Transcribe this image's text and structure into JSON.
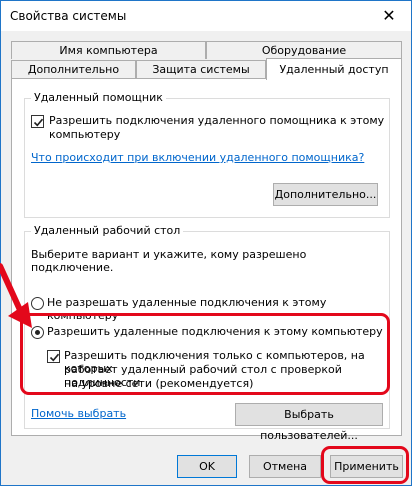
{
  "window": {
    "title": "Свойства системы",
    "close_glyph": "✕"
  },
  "tabs": {
    "row_back": [
      {
        "label": "Имя компьютера"
      },
      {
        "label": "Оборудование"
      }
    ],
    "row_front": [
      {
        "label": "Дополнительно"
      },
      {
        "label": "Защита системы"
      },
      {
        "label": "Удаленный доступ",
        "active": true
      }
    ]
  },
  "remote_assistance": {
    "group_label": "Удаленный помощник",
    "allow_checkbox": {
      "checked": true,
      "label_line1": "Разрешить подключения удаленного помощника к этому",
      "label_line2": "компьютеру"
    },
    "info_link": "Что происходит при включении удаленного помощника?",
    "advanced_button": "Дополнительно..."
  },
  "remote_desktop": {
    "group_label": "Удаленный рабочий стол",
    "instruction": "Выберите вариант и укажите, кому разрешено подключение.",
    "radio_deny": {
      "selected": false,
      "label": "Не разрешать удаленные подключения к этому компьютеру"
    },
    "radio_allow": {
      "selected": true,
      "label": "Разрешить удаленные подключения к этому компьютеру"
    },
    "nla_checkbox": {
      "checked": true,
      "label_line1": "Разрешить подключения только с компьютеров, на которых",
      "label_line2": "работает удаленный рабочий стол с проверкой подлинности",
      "label_line3": "на уровне сети (рекомендуется)"
    },
    "help_link": "Помочь выбрать",
    "select_users_button": "Выбрать пользователей..."
  },
  "footer": {
    "ok": "OK",
    "cancel": "Отмена",
    "apply": "Применить"
  },
  "colors": {
    "annotation_red": "#e3081b",
    "link_blue": "#0066cc",
    "window_border": "#1f75c8"
  }
}
